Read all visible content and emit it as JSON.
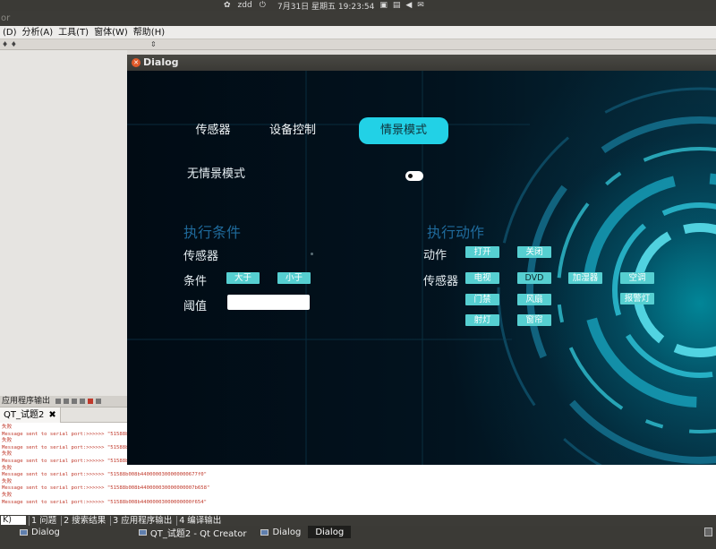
{
  "system_panel": {
    "user": "zdd",
    "datetime": "7月31日 星期五 19:23:54"
  },
  "window": {
    "title_fragment": "or"
  },
  "menubar": [
    "(D)",
    "分析(A)",
    "工具(T)",
    "窗体(W)",
    "帮助(H)"
  ],
  "subbar": {
    "left": "♦ ♦",
    "mid": "⇕"
  },
  "output_pane": {
    "header": "应用程序输出",
    "tab_label": "QT_试题2",
    "log": [
      "失败",
      "Message sent to serial port:>>>>>> \"51588b008b44",
      "失败",
      "Message sent to serial port:>>>>>> \"51588b008b44",
      "失败",
      "Message sent to serial port:>>>>>> \"51588b008b44",
      "失败",
      "Message sent to serial port:>>>>>> \"51588b008b4400000300000000677f0\"",
      "失败",
      "Message sent to serial port:>>>>>> \"51588b008b440000030000000007b658\"",
      "失败",
      "Message sent to serial port:>>>>>> \"51588b008b44000003000000000f654\""
    ]
  },
  "bottom_strip": {
    "field": "K)",
    "buttons": [
      "1 问题",
      "2 搜索结果",
      "3 应用程序输出",
      "4 编译输出"
    ]
  },
  "taskbar": {
    "tasks": [
      "Dialog",
      "QT_试题2 - Qt Creator",
      "Dialog",
      "Dialog"
    ]
  },
  "dialog": {
    "title": "Dialog",
    "tabs": [
      "传感器",
      "设备控制",
      "情景模式"
    ],
    "no_scene_label": "无情景模式",
    "conditions": {
      "heading": "执行条件",
      "sensor_label": "传感器",
      "condition_label": "条件",
      "condition_buttons": [
        "大于",
        "小于"
      ],
      "threshold_label": "阈值",
      "threshold_value": ""
    },
    "actions": {
      "heading": "执行动作",
      "action_label": "动作",
      "action_buttons": [
        "打开",
        "关闭"
      ],
      "sensor_label": "传感器",
      "devices": [
        "电视",
        "DVD",
        "加湿器",
        "空调",
        "门禁",
        "风扇",
        "报警灯",
        "射灯",
        "窗帘"
      ]
    }
  },
  "colors": {
    "accent": "#22d1e6",
    "heading": "#1f6a9b",
    "button": "#56cfd1",
    "dialog_bg": "#010d16"
  }
}
